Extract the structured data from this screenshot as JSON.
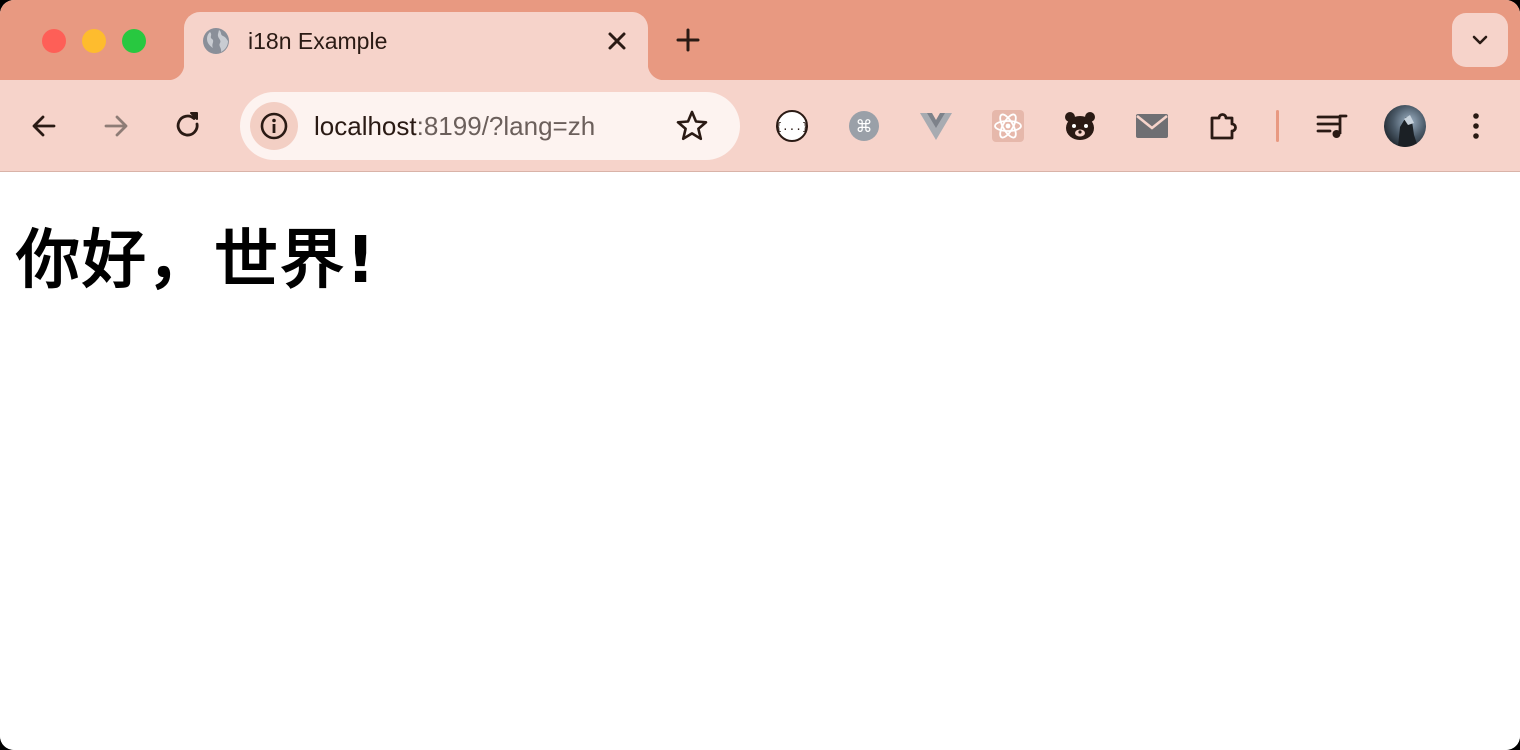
{
  "window": {
    "traffic_lights": [
      "close",
      "minimize",
      "maximize"
    ],
    "colors": {
      "frame": "#e89981",
      "toolbar": "#f6d3ca",
      "omnibox": "#fdf3f0"
    }
  },
  "tab": {
    "title": "i18n Example",
    "favicon": "globe-icon",
    "close_icon": "close-icon"
  },
  "tabstrip": {
    "new_tab_icon": "plus-icon",
    "tab_search_icon": "chevron-down-icon"
  },
  "toolbar": {
    "back_icon": "back-arrow-icon",
    "forward_icon": "forward-arrow-icon",
    "reload_icon": "reload-icon",
    "address": {
      "host": "localhost",
      "rest": ":8199/?lang=zh",
      "site_info_icon": "info-icon",
      "bookmark_icon": "star-icon"
    },
    "extensions": [
      "json-formatter-icon",
      "command-icon",
      "vue-devtools-icon",
      "react-devtools-icon",
      "bear-icon",
      "mail-icon",
      "puzzle-icon"
    ],
    "media_icon": "queue-music-icon",
    "profile_icon": "avatar",
    "menu_icon": "kebab-menu-icon"
  },
  "page": {
    "heading": "你好，世界!"
  }
}
